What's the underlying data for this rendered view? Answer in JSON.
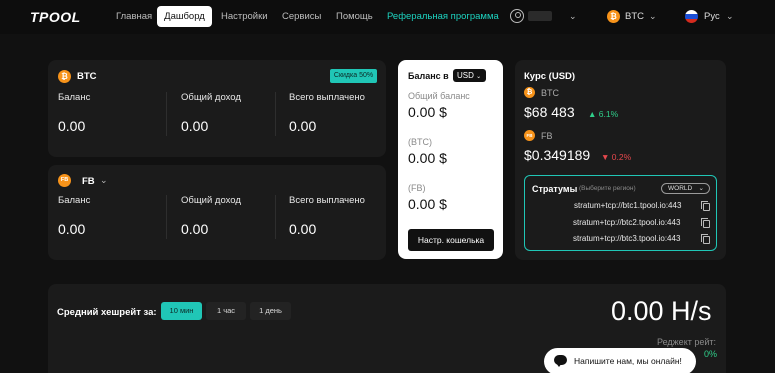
{
  "nav": {
    "logo": "TPOOL",
    "items": [
      "Главная",
      "Дашборд",
      "Настройки",
      "Сервисы",
      "Помощь",
      "Реферальная программа"
    ],
    "currency": "BTC",
    "language": "Рус"
  },
  "btc_card": {
    "coin": "BTC",
    "coin_icon": "₿",
    "discount_badge": "Скидка 50%",
    "balance_label": "Баланс",
    "balance_value": "0.00",
    "income_label": "Общий доход",
    "income_value": "0.00",
    "paid_label": "Всего выплачено",
    "paid_value": "0.00"
  },
  "fb_card": {
    "coin": "FB",
    "coin_icon": "FB",
    "balance_label": "Баланс",
    "balance_value": "0.00",
    "income_label": "Общий доход",
    "income_value": "0.00",
    "paid_label": "Всего выплачено",
    "paid_value": "0.00"
  },
  "balance_panel": {
    "title": "Баланс в",
    "currency": "USD",
    "total_label": "Общий баланс",
    "total_value": "0.00 $",
    "btc_label": "(BTC)",
    "btc_value": "0.00 $",
    "fb_label": "(FB)",
    "fb_value": "0.00 $",
    "wallet_button": "Настр. кошелька"
  },
  "rates": {
    "title": "Курс (USD)",
    "btc_label": "BTC",
    "btc_price": "$68 483",
    "btc_change": "6.1%",
    "fb_label": "FB",
    "fb_price": "$0.349189",
    "fb_change": "0.2%"
  },
  "stratum": {
    "title": "Стратумы",
    "hint": "(Выберите регион)",
    "region": "WORLD",
    "urls": [
      "stratum+tcp://btc1.tpool.io:443",
      "stratum+tcp://btc2.tpool.io:443",
      "stratum+tcp://btc3.tpool.io:443"
    ]
  },
  "hashrate": {
    "label": "Средний хешрейт за:",
    "tabs": [
      "10 мин",
      "1 час",
      "1 день"
    ],
    "value": "0.00 H/s",
    "reject_label": "Реджект рейт:",
    "reject_value": "0%"
  },
  "chat": {
    "text": "Напишите нам, мы онлайн!"
  },
  "colors": {
    "accent": "#20c6b6",
    "btc": "#f7931a",
    "positive": "#2fcf8a",
    "negative": "#e5484d"
  }
}
